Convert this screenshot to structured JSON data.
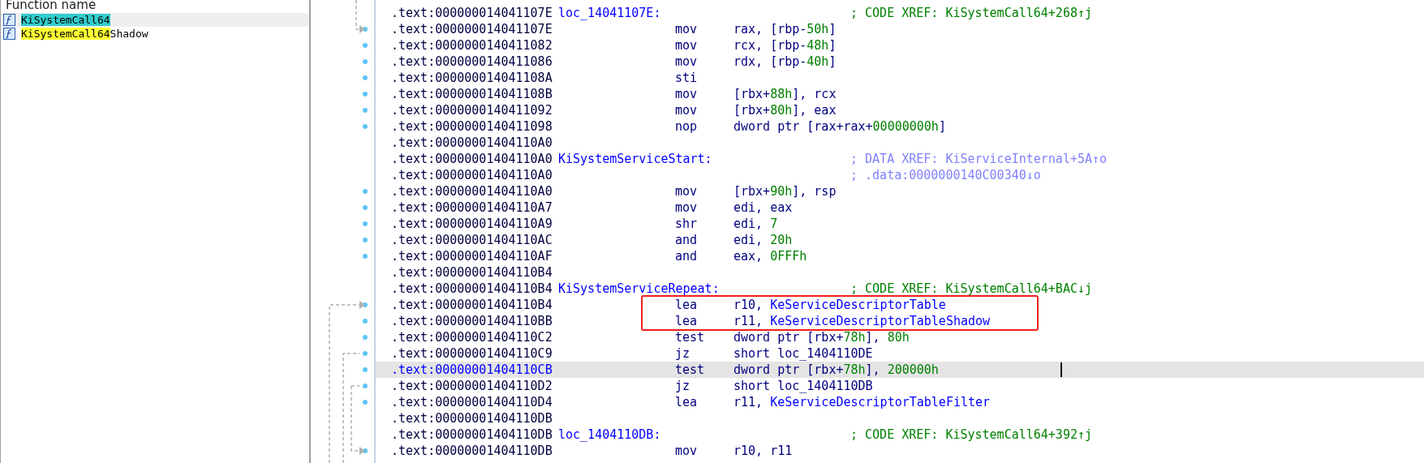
{
  "functions_panel": {
    "header": "Function name",
    "items": [
      {
        "match": "KiSystemCall64",
        "selected": true
      },
      {
        "match": "KiSystemCall64",
        "rest": "Shadow",
        "selected": false
      }
    ]
  },
  "listing": {
    "blocks": [
      {
        "kind": "plain",
        "rows": [
          {
            "address": ".text:000000014041107E",
            "label": "loc_14041107E:",
            "comment": {
              "text": "; CODE XREF: KiSystemCall64+268↑j",
              "kind": "code"
            },
            "dot": false,
            "selected": false
          },
          {
            "address": ".text:000000014041107E",
            "mnemonic": "mov",
            "operands": [
              {
                "t": "rax, [rbp-",
                "kind": "reg"
              },
              {
                "t": "50h",
                "kind": "num"
              },
              {
                "t": "]",
                "kind": "reg"
              }
            ],
            "dot": true,
            "selected": false
          },
          {
            "address": ".text:0000000140411082",
            "mnemonic": "mov",
            "operands": [
              {
                "t": "rcx, [rbp-",
                "kind": "reg"
              },
              {
                "t": "48h",
                "kind": "num"
              },
              {
                "t": "]",
                "kind": "reg"
              }
            ],
            "dot": true,
            "selected": false
          },
          {
            "address": ".text:0000000140411086",
            "mnemonic": "mov",
            "operands": [
              {
                "t": "rdx, [rbp-",
                "kind": "reg"
              },
              {
                "t": "40h",
                "kind": "num"
              },
              {
                "t": "]",
                "kind": "reg"
              }
            ],
            "dot": true,
            "selected": false
          },
          {
            "address": ".text:000000014041108A",
            "mnemonic": "sti",
            "dot": true,
            "selected": false
          },
          {
            "address": ".text:000000014041108B",
            "mnemonic": "mov",
            "operands": [
              {
                "t": "[rbx+",
                "kind": "reg"
              },
              {
                "t": "88h",
                "kind": "num"
              },
              {
                "t": "], rcx",
                "kind": "reg"
              }
            ],
            "dot": true,
            "selected": false
          },
          {
            "address": ".text:0000000140411092",
            "mnemonic": "mov",
            "operands": [
              {
                "t": "[rbx+",
                "kind": "reg"
              },
              {
                "t": "80h",
                "kind": "num"
              },
              {
                "t": "], eax",
                "kind": "reg"
              }
            ],
            "dot": true,
            "selected": false
          },
          {
            "address": ".text:0000000140411098",
            "mnemonic": "nop",
            "operands": [
              {
                "t": "dword ptr [rax+rax+",
                "kind": "reg"
              },
              {
                "t": "00000000h",
                "kind": "num"
              },
              {
                "t": "]",
                "kind": "reg"
              }
            ],
            "dot": true,
            "selected": false
          },
          {
            "address": ".text:00000001404110A0",
            "dot": false,
            "selected": false
          },
          {
            "address": ".text:00000001404110A0",
            "label": "KiSystemServiceStart:",
            "comment": {
              "text": "; DATA XREF: KiServiceInternal+5A↑o",
              "kind": "data"
            },
            "dot": false,
            "selected": false
          },
          {
            "address": ".text:00000001404110A0",
            "comment": {
              "text": "; .data:0000000140C00340↓o",
              "kind": "data"
            },
            "dot": false,
            "selected": false
          },
          {
            "address": ".text:00000001404110A0",
            "mnemonic": "mov",
            "operands": [
              {
                "t": "[rbx+",
                "kind": "reg"
              },
              {
                "t": "90h",
                "kind": "num"
              },
              {
                "t": "], rsp",
                "kind": "reg"
              }
            ],
            "dot": true,
            "selected": false
          },
          {
            "address": ".text:00000001404110A7",
            "mnemonic": "mov",
            "operands": [
              {
                "t": "edi, eax",
                "kind": "reg"
              }
            ],
            "dot": true,
            "selected": false
          },
          {
            "address": ".text:00000001404110A9",
            "mnemonic": "shr",
            "operands": [
              {
                "t": "edi, ",
                "kind": "reg"
              },
              {
                "t": "7",
                "kind": "num"
              }
            ],
            "dot": true,
            "selected": false
          },
          {
            "address": ".text:00000001404110AC",
            "mnemonic": "and",
            "operands": [
              {
                "t": "edi, ",
                "kind": "reg"
              },
              {
                "t": "20h",
                "kind": "num"
              }
            ],
            "dot": true,
            "selected": false
          },
          {
            "address": ".text:00000001404110AF",
            "mnemonic": "and",
            "operands": [
              {
                "t": "eax, ",
                "kind": "reg"
              },
              {
                "t": "0FFFh",
                "kind": "num"
              }
            ],
            "dot": true,
            "selected": false
          },
          {
            "address": ".text:00000001404110B4",
            "dot": false,
            "selected": false
          },
          {
            "address": ".text:00000001404110B4",
            "label": "KiSystemServiceRepeat:",
            "comment": {
              "text": "; CODE XREF: KiSystemCall64+BAC↓j",
              "kind": "code"
            },
            "dot": false,
            "selected": false
          }
        ]
      },
      {
        "kind": "boxed",
        "rows": [
          {
            "address": ".text:00000001404110B4",
            "mnemonic": "lea",
            "operands": [
              {
                "t": "r10, ",
                "kind": "reg"
              },
              {
                "t": "KeServiceDescriptorTable",
                "kind": "name"
              }
            ],
            "dot": true,
            "selected": false
          },
          {
            "address": ".text:00000001404110BB",
            "mnemonic": "lea",
            "operands": [
              {
                "t": "r11, ",
                "kind": "reg"
              },
              {
                "t": "KeServiceDescriptorTableShadow",
                "kind": "name"
              }
            ],
            "dot": true,
            "selected": false
          }
        ]
      },
      {
        "kind": "plain",
        "rows": [
          {
            "address": ".text:00000001404110C2",
            "mnemonic": "test",
            "operands": [
              {
                "t": "dword ptr [rbx+",
                "kind": "reg"
              },
              {
                "t": "78h",
                "kind": "num"
              },
              {
                "t": "], ",
                "kind": "reg"
              },
              {
                "t": "80h",
                "kind": "num"
              }
            ],
            "dot": true,
            "selected": false
          },
          {
            "address": ".text:00000001404110C9",
            "mnemonic": "jz",
            "operands": [
              {
                "t": "short loc_1404110DE",
                "kind": "reg"
              }
            ],
            "dot": true,
            "selected": false
          },
          {
            "address": ".text:00000001404110CB",
            "mnemonic": "test",
            "operands": [
              {
                "t": "dword ptr [rbx+",
                "kind": "reg"
              },
              {
                "t": "78h",
                "kind": "num"
              },
              {
                "t": "], ",
                "kind": "reg"
              },
              {
                "t": "200000h",
                "kind": "num"
              }
            ],
            "dot": true,
            "selected": true
          },
          {
            "address": ".text:00000001404110D2",
            "mnemonic": "jz",
            "operands": [
              {
                "t": "short loc_1404110DB",
                "kind": "reg"
              }
            ],
            "dot": true,
            "selected": false
          },
          {
            "address": ".text:00000001404110D4",
            "mnemonic": "lea",
            "operands": [
              {
                "t": "r11, ",
                "kind": "reg"
              },
              {
                "t": "KeServiceDescriptorTableFilter",
                "kind": "name"
              }
            ],
            "dot": true,
            "selected": false
          },
          {
            "address": ".text:00000001404110DB",
            "dot": false,
            "selected": false
          },
          {
            "address": ".text:00000001404110DB",
            "label": "loc_1404110DB:",
            "comment": {
              "text": "; CODE XREF: KiSystemCall64+392↑j",
              "kind": "code"
            },
            "dot": false,
            "selected": false
          },
          {
            "address": ".text:00000001404110DB",
            "mnemonic": "mov",
            "operands": [
              {
                "t": "r10, r11",
                "kind": "reg"
              }
            ],
            "dot": true,
            "selected": false
          }
        ]
      }
    ]
  }
}
